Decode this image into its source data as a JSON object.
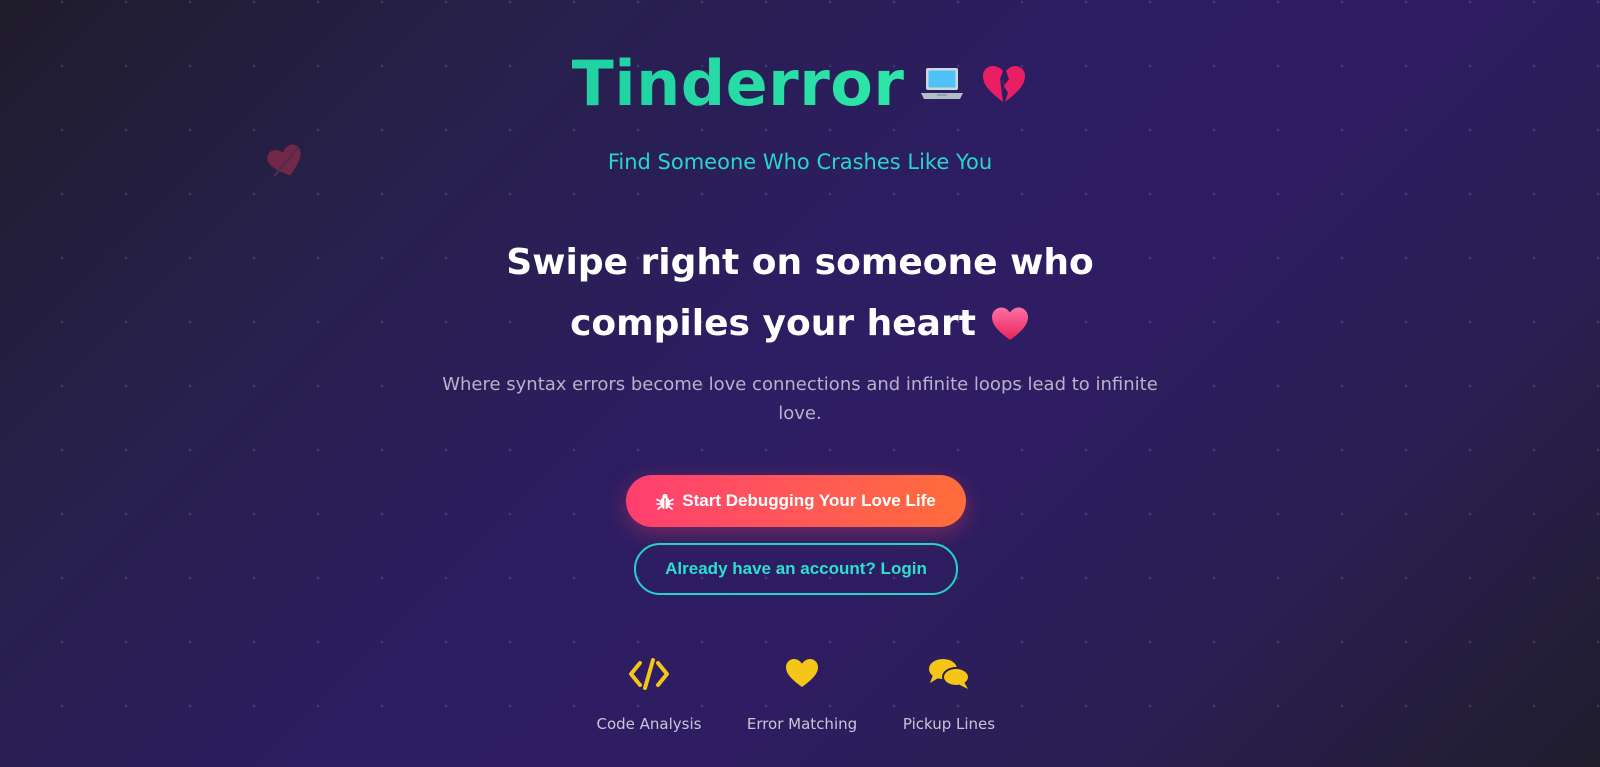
{
  "brand": {
    "name": "Tinderror",
    "tagline": "Find Someone Who Crashes Like You",
    "icons": [
      "laptop-icon",
      "broken-heart-icon"
    ]
  },
  "hero": {
    "headline_line1": "Swipe right on someone who",
    "headline_line2": "compiles your heart",
    "headline_icon": "heart-icon",
    "description": "Where syntax errors become love connections and infinite loops lead to infinite love."
  },
  "actions": {
    "primary_label": "Start Debugging Your Love Life",
    "primary_icon": "bug-icon",
    "secondary_label": "Already have an account? Login"
  },
  "features": [
    {
      "label": "Code Analysis",
      "icon": "code-icon"
    },
    {
      "label": "Error Matching",
      "icon": "heart-icon"
    },
    {
      "label": "Pickup Lines",
      "icon": "chat-bubbles-icon"
    }
  ],
  "colors": {
    "brand_green": "#2ee6a6",
    "accent_teal": "#27d7c9",
    "primary_gradient_start": "#ff3f70",
    "primary_gradient_end": "#ff6d3a",
    "feature_icon_yellow": "#f5c518",
    "background": "#2d1d63"
  }
}
